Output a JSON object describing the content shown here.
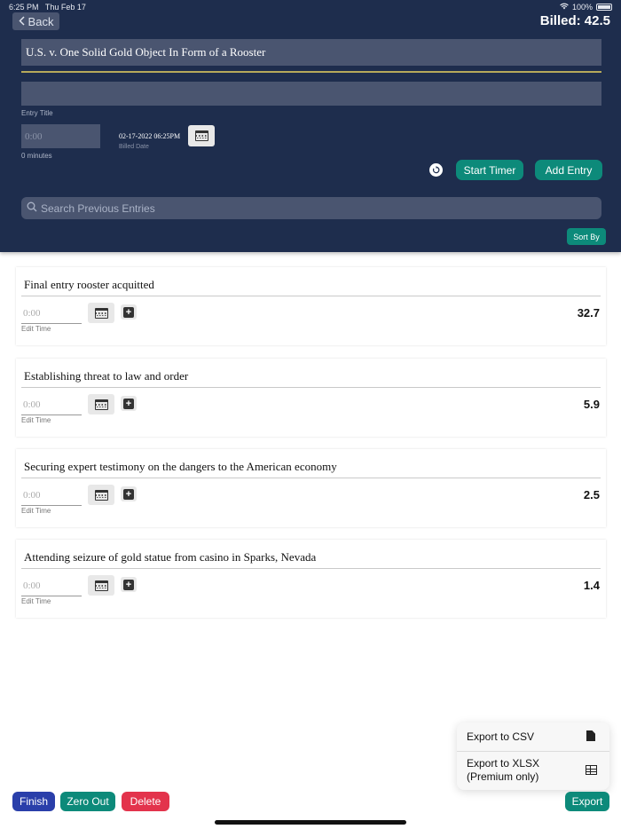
{
  "status_bar": {
    "time": "6:25 PM",
    "date": "Thu Feb 17",
    "battery": "100%"
  },
  "header": {
    "back_label": "Back",
    "billed_total": "Billed: 42.5",
    "case_title": "U.S. v. One Solid Gold Object In Form of a Rooster",
    "entry_title_label": "Entry Title",
    "time_placeholder": "0:00",
    "minutes_label": "0 minutes",
    "billed_date": "02-17-2022 06:25PM",
    "billed_date_label": "Billed Date",
    "start_timer_label": "Start Timer",
    "add_entry_label": "Add Entry",
    "search_placeholder": "Search Previous Entries",
    "sort_by_label": "Sort By"
  },
  "entries": [
    {
      "title": "Final entry rooster acquitted",
      "time": "0:00",
      "edit_label": "Edit Time",
      "amount": "32.7"
    },
    {
      "title": "Establishing threat to law and order",
      "time": "0:00",
      "edit_label": "Edit Time",
      "amount": "5.9"
    },
    {
      "title": "Securing expert testimony on the dangers to the American economy",
      "time": "0:00",
      "edit_label": "Edit Time",
      "amount": "2.5"
    },
    {
      "title": "Attending seizure of gold statue from casino in Sparks, Nevada",
      "time": "0:00",
      "edit_label": "Edit Time",
      "amount": "1.4"
    }
  ],
  "export_menu": {
    "csv_label": "Export to CSV",
    "xlsx_label_line1": "Export to XLSX",
    "xlsx_label_line2": "(Premium only)"
  },
  "footer": {
    "finish_label": "Finish",
    "zero_out_label": "Zero Out",
    "delete_label": "Delete",
    "export_label": "Export"
  },
  "colors": {
    "header_bg": "#1e2d4d",
    "accent_teal": "#0d8a7a",
    "finish_blue": "#2a3faa",
    "delete_red": "#e3334c"
  }
}
